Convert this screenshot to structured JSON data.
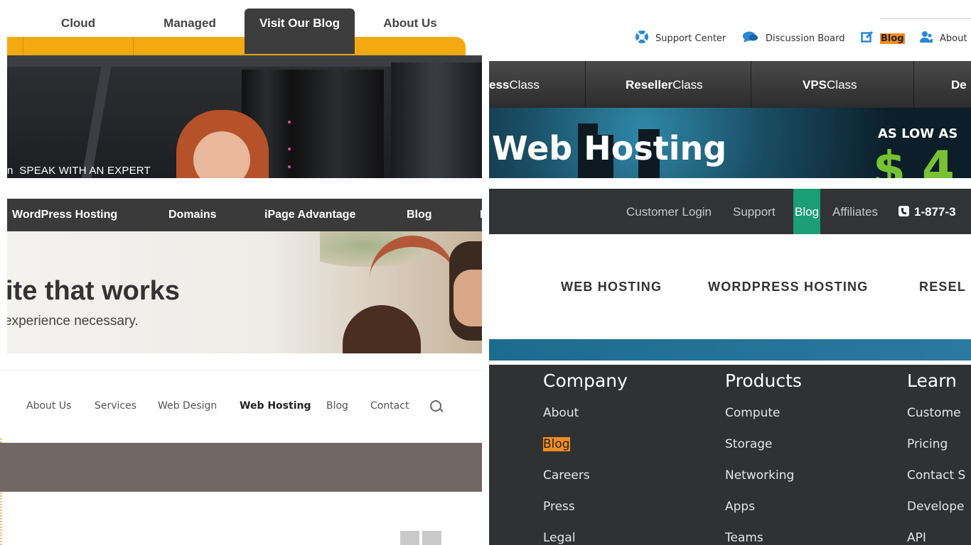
{
  "panel1": {
    "tabs": [
      "Cloud",
      "Managed",
      "Visit Our Blog",
      "About Us"
    ],
    "active_tab": "Visit Our Blog",
    "overlay_text": "SPEAK WITH AN EXPERT",
    "overlay_prefix": "n",
    "colors": {
      "orange": "#f5a910",
      "active_tab": "#3d3d3d"
    }
  },
  "panel2": {
    "utility_links": [
      {
        "label": "Support Center",
        "icon": "lifebuoy-icon"
      },
      {
        "label": "Discussion Board",
        "icon": "chat-bubble-icon"
      },
      {
        "label": "Blog",
        "icon": "edit-icon"
      },
      {
        "label": "About",
        "icon": "users-icon"
      }
    ],
    "nav": [
      {
        "bold": "ess",
        "rest": "Class"
      },
      {
        "bold": "Reseller",
        "rest": "Class"
      },
      {
        "bold": "VPS",
        "rest": "Class"
      },
      {
        "bold": "De",
        "rest": ""
      }
    ],
    "banner_title": "Web Hosting",
    "banner_low": "AS LOW AS",
    "banner_price": "$ 4",
    "colors": {
      "blog_highlight": "#f28c22",
      "price": "#77c233"
    }
  },
  "panel3": {
    "nav": [
      "WordPress Hosting",
      "Domains",
      "iPage Advantage",
      "Blog",
      "F"
    ],
    "headline": "ite that works",
    "subhead": "experience necessary."
  },
  "panel4": {
    "utility": [
      "Customer Login",
      "Support",
      "Blog",
      "Affiliates"
    ],
    "phone": "1-877-3",
    "main_nav": [
      "WEB HOSTING",
      "WORDPRESS HOSTING",
      "RESEL"
    ],
    "colors": {
      "blog_highlight": "#1b9e74"
    }
  },
  "panel5": {
    "nav": [
      "About Us",
      "Services",
      "Web Design",
      "Web Hosting",
      "Blog",
      "Contact"
    ],
    "active": "Web Hosting"
  },
  "panel6": {
    "columns": [
      {
        "heading": "Company",
        "links": [
          "About",
          "Blog",
          "Careers",
          "Press",
          "Legal"
        ]
      },
      {
        "heading": "Products",
        "links": [
          "Compute",
          "Storage",
          "Networking",
          "Apps",
          "Teams"
        ]
      },
      {
        "heading": "Learn",
        "links": [
          "Custome",
          "Pricing",
          "Contact S",
          "Develope",
          "API"
        ]
      }
    ],
    "highlight": "Blog"
  }
}
